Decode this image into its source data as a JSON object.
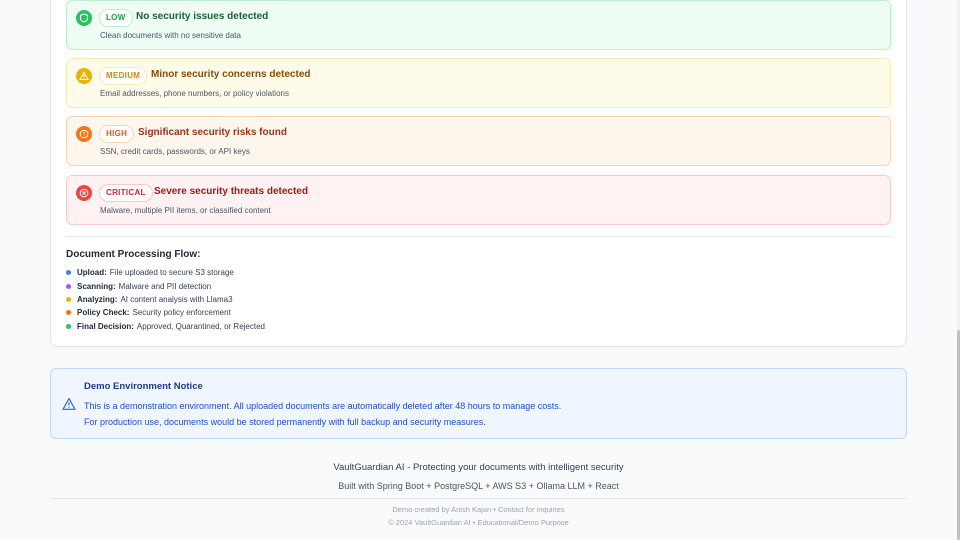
{
  "risk_levels": [
    {
      "level": "LOW",
      "title": "No security issues detected",
      "description": "Clean documents with no sensitive data",
      "icon": "shield-check-icon",
      "color": "#22c55e"
    },
    {
      "level": "MEDIUM",
      "title": "Minor security concerns detected",
      "description": "Email addresses, phone numbers, or policy violations",
      "icon": "warning-triangle-icon",
      "color": "#eab308"
    },
    {
      "level": "HIGH",
      "title": "Significant security risks found",
      "description": "SSN, credit cards, passwords, or API keys",
      "icon": "alert-circle-icon",
      "color": "#f97316"
    },
    {
      "level": "CRITICAL",
      "title": "Severe security threats detected",
      "description": "Malware, multiple PII items, or classified content",
      "icon": "x-circle-icon",
      "color": "#ef4444"
    }
  ],
  "flow": {
    "title": "Document Processing Flow:",
    "steps": [
      {
        "name": "Upload:",
        "text": "File uploaded to secure S3 storage",
        "color": "#3b82f6"
      },
      {
        "name": "Scanning:",
        "text": "Malware and PII detection",
        "color": "#a855f7"
      },
      {
        "name": "Analyzing:",
        "text": "AI content analysis with Llama3",
        "color": "#eab308"
      },
      {
        "name": "Policy Check:",
        "text": "Security policy enforcement",
        "color": "#f97316"
      },
      {
        "name": "Final Decision:",
        "text": "Approved, Quarantined, or Rejected",
        "color": "#22c55e"
      }
    ]
  },
  "notice": {
    "title": "Demo Environment Notice",
    "line1": "This is a demonstration environment. All uploaded documents are automatically deleted after 48 hours to manage costs.",
    "line2": "For production use, documents would be stored permanently with full backup and security measures.",
    "icon": "warning-triangle-icon"
  },
  "footer": {
    "tagline": "VaultGuardian AI - Protecting your documents with intelligent security",
    "stack": "Built with Spring Boot + PostgreSQL + AWS S3 + Ollama LLM + React",
    "credit": "Demo created by Anish Kajan • Contact for inquiries",
    "copyright": "© 2024 VaultGuardian AI • Educational/Demo Purpose"
  }
}
